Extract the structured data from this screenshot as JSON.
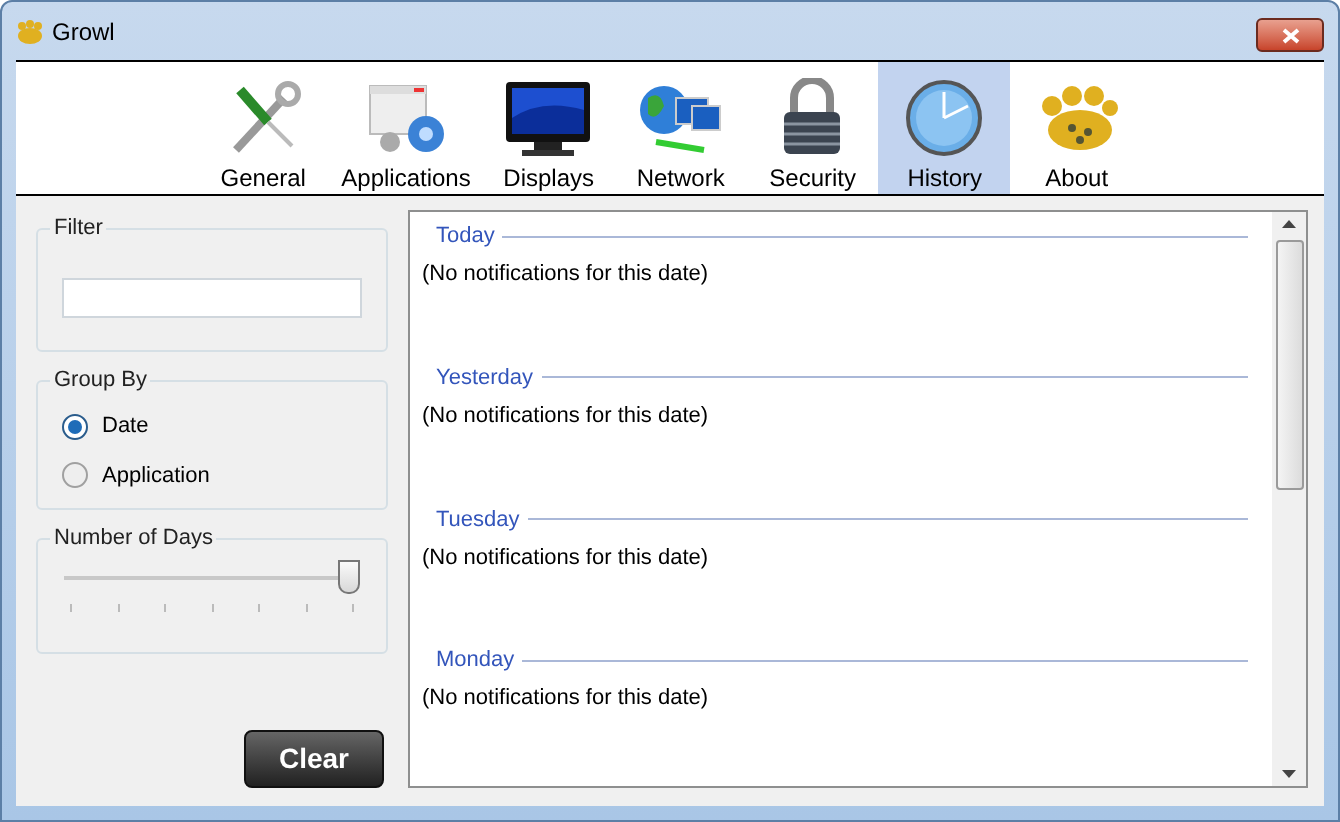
{
  "window": {
    "title": "Growl"
  },
  "tabs": [
    {
      "label": "General",
      "selected": false
    },
    {
      "label": "Applications",
      "selected": false
    },
    {
      "label": "Displays",
      "selected": false
    },
    {
      "label": "Network",
      "selected": false
    },
    {
      "label": "Security",
      "selected": false
    },
    {
      "label": "History",
      "selected": true
    },
    {
      "label": "About",
      "selected": false
    }
  ],
  "filter": {
    "title": "Filter"
  },
  "group_by": {
    "title": "Group By",
    "options": [
      {
        "label": "Date",
        "selected": true
      },
      {
        "label": "Application",
        "selected": false
      }
    ]
  },
  "days": {
    "title": "Number of Days",
    "level": 1
  },
  "clear_button": "Clear",
  "history": [
    {
      "date": "Today",
      "message": "(No notifications for this date)"
    },
    {
      "date": "Yesterday",
      "message": "(No notifications for this date)"
    },
    {
      "date": "Tuesday",
      "message": "(No notifications for this date)"
    },
    {
      "date": "Monday",
      "message": "(No notifications for this date)"
    }
  ]
}
